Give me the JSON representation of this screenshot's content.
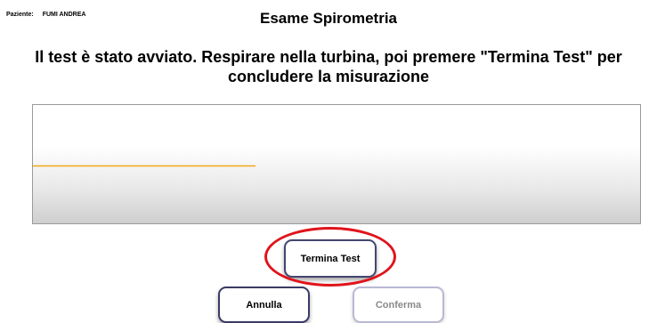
{
  "patient": {
    "label": "Paziente:",
    "name": "FUMI ANDREA"
  },
  "header": {
    "title": "Esame Spirometria"
  },
  "instructions": {
    "line1": "Il test è stato avviato. Respirare nella turbina, poi premere \"Termina Test\" per",
    "line2": "concludere la misurazione"
  },
  "chart_data": {
    "type": "line",
    "title": "",
    "xlabel": "",
    "ylabel": "",
    "progress_fraction": 0.365,
    "trace_level_fraction": 0.5,
    "trace_color": "#f0a91a",
    "grid": false
  },
  "buttons": {
    "termina_label": "Termina Test",
    "annulla_label": "Annulla",
    "conferma_label": "Conferma"
  },
  "colors": {
    "annotation_circle": "#e0141b",
    "button_border": "#45456f",
    "button_disabled_border": "#b9b9d4"
  }
}
